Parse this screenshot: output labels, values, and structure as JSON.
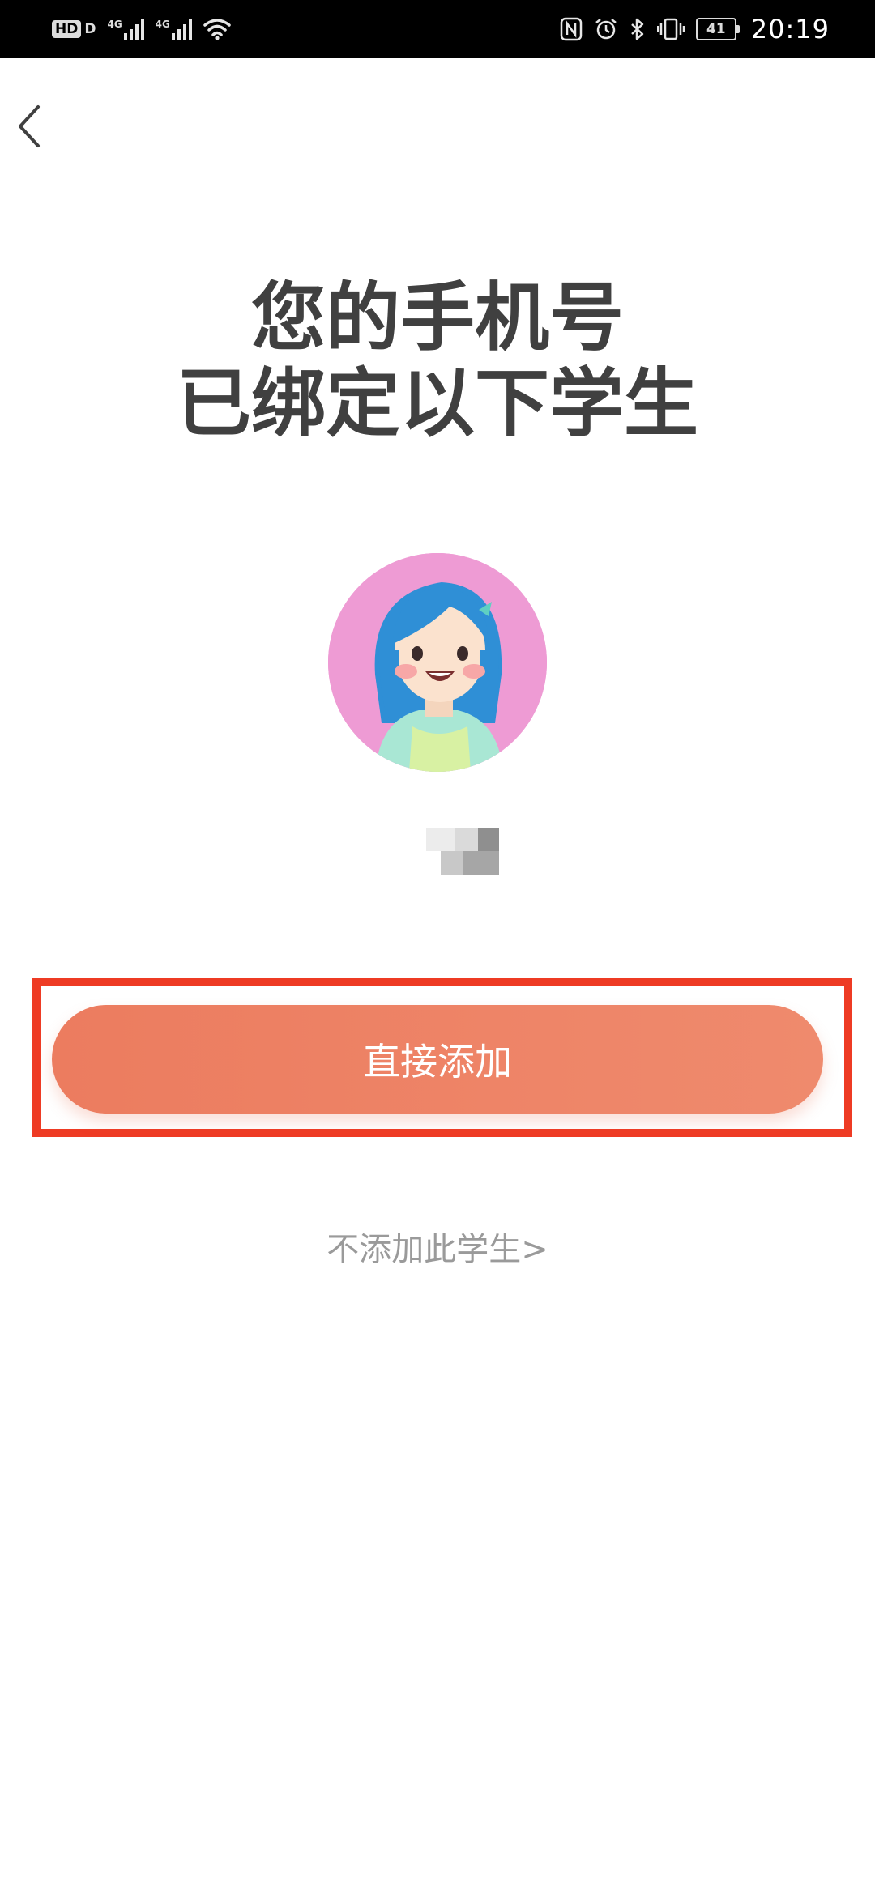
{
  "status_bar": {
    "hd_label": "HD",
    "hd_suffix": "D",
    "network_1": "4G",
    "network_2": "4G",
    "battery_level": "41",
    "time": "20:19"
  },
  "header": {
    "back_icon": "chevron-left-icon"
  },
  "title": {
    "line1": "您的手机号",
    "line2": "已绑定以下学生"
  },
  "student": {
    "avatar_icon": "girl-avatar-icon",
    "avatar_bg": "#ee9bd4"
  },
  "actions": {
    "add_label": "直接添加",
    "skip_label": "不添加此学生>",
    "add_color": "#ec7c5f",
    "highlight_color": "#ee3b24"
  }
}
